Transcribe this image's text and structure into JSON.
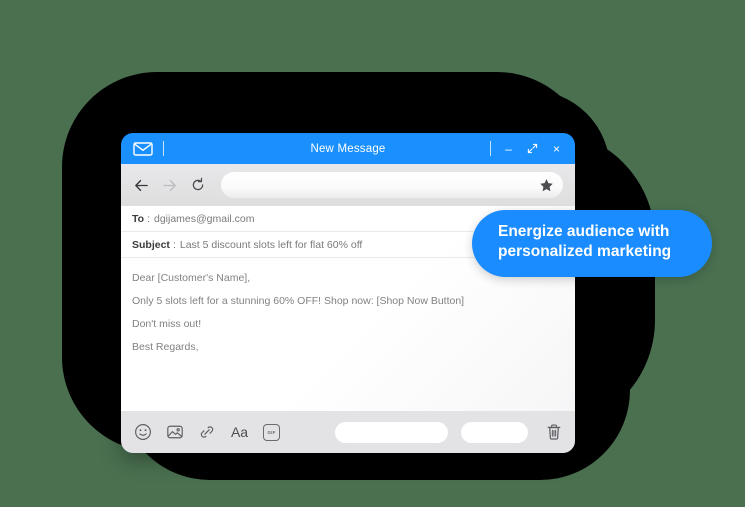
{
  "background": {
    "color": "#4a7050",
    "blob_color": "#000000"
  },
  "window": {
    "titlebar": {
      "app_icon": "envelope-icon",
      "title": "New Message",
      "accent_color": "#1a90ff",
      "controls": {
        "minimize": "–",
        "maximize": "⤡",
        "close": "×"
      }
    },
    "navbar": {
      "back_icon": "arrow-left-icon",
      "forward_icon": "arrow-right-icon",
      "reload_icon": "reload-icon",
      "url_value": "",
      "url_placeholder": "",
      "bookmark_icon": "star-icon"
    },
    "fields": [
      {
        "label": "To",
        "separator": ":",
        "value": "dgijames@gmail.com"
      },
      {
        "label": "Subject",
        "separator": ":",
        "value": "Last 5 discount slots left for flat 60% off"
      }
    ],
    "compose_lines": [
      "Dear [Customer's Name],",
      "Only 5 slots left for a stunning 60% OFF! Shop now: [Shop Now Button]",
      "Don't miss out!",
      "Best Regards,"
    ],
    "footer": {
      "tools": [
        {
          "name": "emoji-icon",
          "label": ""
        },
        {
          "name": "image-icon",
          "label": ""
        },
        {
          "name": "link-icon",
          "label": ""
        },
        {
          "name": "text-format-icon",
          "label": "Aa"
        },
        {
          "name": "gif-icon",
          "label": "GIF"
        }
      ],
      "primary_button_label": "",
      "secondary_button_label": "",
      "delete_icon": "trash-icon"
    }
  },
  "callout": {
    "text": "Energize audience with personalized marketing",
    "color": "#1a8cff",
    "text_color": "#ffffff"
  }
}
